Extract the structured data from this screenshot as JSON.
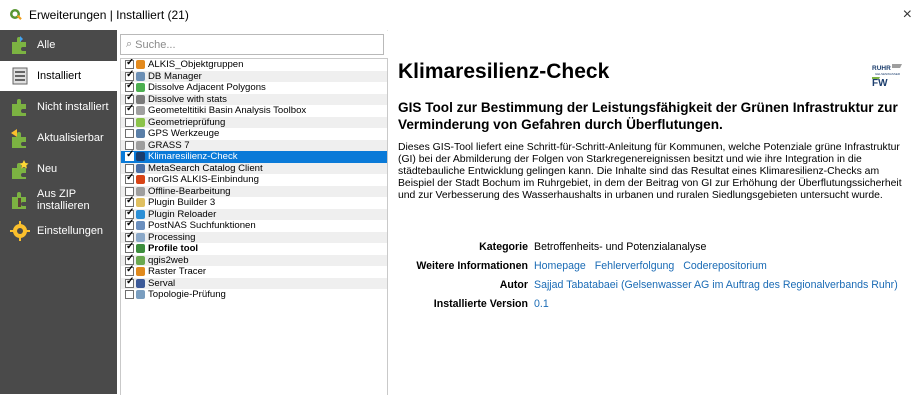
{
  "window": {
    "title": "Erweiterungen | Installiert (21)",
    "close_glyph": "×"
  },
  "sidebar": {
    "items": [
      {
        "label": "Alle",
        "icon": "puzzle-icon"
      },
      {
        "label": "Installiert",
        "icon": "puzzle-installed-icon",
        "active": true
      },
      {
        "label": "Nicht installiert",
        "icon": "puzzle-not-installed-icon"
      },
      {
        "label": "Aktualisierbar",
        "icon": "puzzle-upgrade-icon"
      },
      {
        "label": "Neu",
        "icon": "puzzle-new-icon"
      },
      {
        "label": "Aus ZIP installieren",
        "icon": "zip-icon"
      },
      {
        "label": "Einstellungen",
        "icon": "settings-icon"
      }
    ]
  },
  "search": {
    "placeholder": "Suche..."
  },
  "plugins": [
    {
      "name": "ALKIS_Objektgruppen",
      "checked": true,
      "icon_color": "#e38a1d"
    },
    {
      "name": "DB Manager",
      "checked": true,
      "icon_color": "#6b8fb5"
    },
    {
      "name": "Dissolve Adjacent Polygons",
      "checked": true,
      "icon_color": "#4caf50"
    },
    {
      "name": "Dissolve with stats",
      "checked": true,
      "icon_color": "#7a7a7a"
    },
    {
      "name": "Geometeltitiki Basin Analysis Toolbox",
      "checked": true,
      "icon_color": "#a0a0a0"
    },
    {
      "name": "Geometrieprüfung",
      "checked": false,
      "icon_color": "#8bc34a"
    },
    {
      "name": "GPS Werkzeuge",
      "checked": false,
      "icon_color": "#5a7fa8"
    },
    {
      "name": "GRASS 7",
      "checked": false,
      "icon_color": "#9e9e9e"
    },
    {
      "name": "Klimaresilienz-Check",
      "checked": true,
      "icon_color": "#1b3d6d",
      "selected": true
    },
    {
      "name": "MetaSearch Catalog Client",
      "checked": false,
      "icon_color": "#4a6fa5"
    },
    {
      "name": "norGIS ALKIS-Einbindung",
      "checked": true,
      "icon_color": "#d84315"
    },
    {
      "name": "Offline-Bearbeitung",
      "checked": false,
      "icon_color": "#9e9e9e"
    },
    {
      "name": "Plugin Builder 3",
      "checked": true,
      "icon_color": "#e0c060"
    },
    {
      "name": "Plugin Reloader",
      "checked": true,
      "icon_color": "#2b8fd6"
    },
    {
      "name": "PostNAS Suchfunktionen",
      "checked": true,
      "icon_color": "#6a8fbf"
    },
    {
      "name": "Processing",
      "checked": true,
      "icon_color": "#8aa8c8"
    },
    {
      "name": "Profile tool",
      "checked": true,
      "icon_color": "#3c8d3c",
      "bold": true
    },
    {
      "name": "qgis2web",
      "checked": true,
      "icon_color": "#6aa84f"
    },
    {
      "name": "Raster Tracer",
      "checked": true,
      "icon_color": "#e08a1e"
    },
    {
      "name": "Serval",
      "checked": true,
      "icon_color": "#3b5998"
    },
    {
      "name": "Topologie-Prüfung",
      "checked": false,
      "icon_color": "#7a9ec0"
    }
  ],
  "details": {
    "title": "Klimaresilienz-Check",
    "subtitle": "GIS Tool zur Bestimmung der Leistungsfähigkeit der Grünen Infrastruktur zur Verminderung von Gefahren durch Überflutungen.",
    "description": "Dieses GIS-Tool liefert eine Schritt-für-Schritt-Anleitung für Kommunen, welche Potenziale grüne Infrastruktur (GI) bei der Abmilderung der Folgen von Starkregenereignissen besitzt und wie ihre Integration in die städtebauliche Entwicklung gelingen kann. Die Inhalte sind das Resultat eines Klimaresilienz-Checks am Beispiel der Stadt Bochum im Ruhrgebiet, in dem der Beitrag von GI zur Erhöhung der Überflutungssicherheit und zur Verbesserung des Wasserhaushalts in urbanen und ruralen Siedlungsgebieten untersucht wurde.",
    "logo_text": {
      "top": "RUHR",
      "mid": "GELSENWASSER",
      "bottom": "FW"
    },
    "category_label": "Kategorie",
    "category_value": "Betroffenheits- und Potenzialanalyse",
    "more_info_label": "Weitere Informationen",
    "links": [
      "Homepage",
      "Fehlerverfolgung",
      "Coderepositorium"
    ],
    "author_label": "Autor",
    "author_value": "Sajjad Tabatabaei (Gelsenwasser AG im Auftrag des Regionalverbands Ruhr)",
    "version_label": "Installierte Version",
    "version_value": "0.1"
  }
}
